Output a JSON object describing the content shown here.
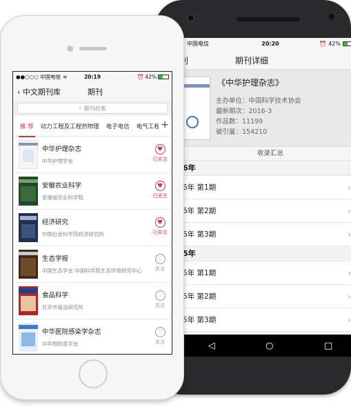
{
  "android": {
    "status": {
      "carrier": "中国电信",
      "time": "20:20",
      "battery": "42%"
    },
    "nav": {
      "back_label": "刊",
      "title": "期刊详细"
    },
    "journal": {
      "title": "《中华护理杂志》",
      "host_label": "主办单位：中国科学技术协会",
      "latest_label": "最新期次：2016-3",
      "works_label": "作品数：11199",
      "cited_label": "被引量：154210"
    },
    "collect_label": "收录汇总",
    "years": [
      {
        "label": "6年",
        "issues": [
          "6年 第1期",
          "6年 第2期",
          "6年 第3期"
        ]
      },
      {
        "label": "5年",
        "issues": [
          "5年 第1期",
          "5年 第2期",
          "5年 第3期"
        ]
      }
    ]
  },
  "iphone": {
    "status": {
      "carrier": "●●○○○ 中国电信",
      "time": "20:19",
      "battery": "42%",
      "battery_level": 0.42
    },
    "nav": {
      "back_label": "中文期刊库",
      "title": "期刊"
    },
    "search": {
      "placeholder": "期刊检索"
    },
    "tabs": [
      "推 荐",
      "动力工程及工程热物理",
      "电子电信",
      "电气工程"
    ],
    "active_tab": 0,
    "journals": [
      {
        "name": "中华护理杂志",
        "publisher": "中华护理学会",
        "followed": true,
        "follow_label": "已关注"
      },
      {
        "name": "安徽农业科学",
        "publisher": "安徽省农业科学院",
        "followed": true,
        "follow_label": "已关注"
      },
      {
        "name": "经济研究",
        "publisher": "中国社会科学院经济研究所",
        "followed": true,
        "follow_label": "已关注"
      },
      {
        "name": "生态学报",
        "publisher": "中国生态学会 中国科学院生态环境研究中心",
        "followed": false,
        "follow_label": "关注"
      },
      {
        "name": "食品科学",
        "publisher": "北京市食品研究所",
        "followed": false,
        "follow_label": "关注"
      },
      {
        "name": "中华医院感染学杂志",
        "publisher": "中华预防医学会",
        "followed": false,
        "follow_label": "关注"
      }
    ]
  },
  "colors": {
    "accent": "#d9333f",
    "android_body": "#2a2a2c",
    "iphone_body": "#f6f6f7"
  }
}
